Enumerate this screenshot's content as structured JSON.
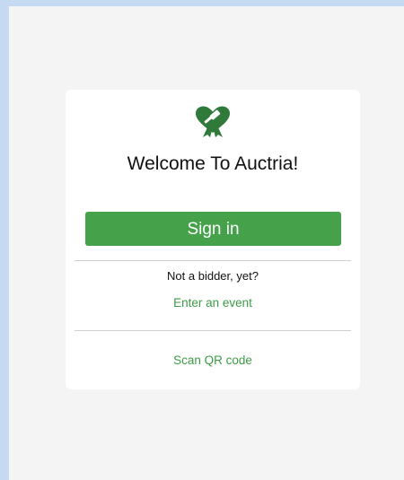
{
  "colors": {
    "outer_frame": "#c6d9f2",
    "screen_background": "#f4f4f4",
    "card_background": "#ffffff",
    "accent_green": "#45a24b",
    "link_green": "#3d9b48",
    "logo_green": "#2f7a3a"
  },
  "logo": {
    "icon": "heart-ribbon-gavel-icon"
  },
  "card": {
    "title": "Welcome To Auctria!",
    "signin_label": "Sign in",
    "prompt_text": "Not a bidder, yet?",
    "enter_event_label": "Enter an event",
    "scan_qr_label": "Scan QR code"
  }
}
